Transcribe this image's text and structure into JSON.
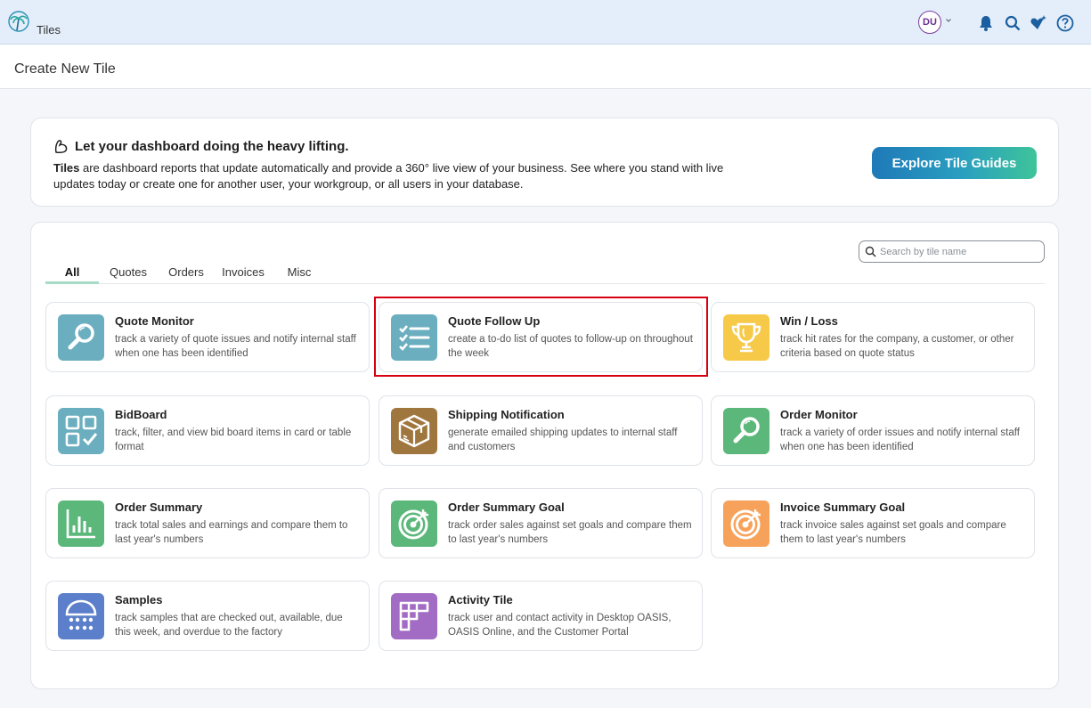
{
  "header": {
    "app_title": "Tiles",
    "avatar_initials": "DU"
  },
  "page": {
    "title": "Create New Tile"
  },
  "intro": {
    "heading": "Let your dashboard doing the heavy lifting.",
    "desc_bold": "Tiles",
    "desc_rest": " are dashboard reports that update automatically and provide a 360° live view of your business. See where you stand with live updates today or create one for another user, your workgroup, or all users in your database.",
    "button_label": "Explore Tile Guides"
  },
  "search": {
    "placeholder": "Search by tile name",
    "value": ""
  },
  "tabs": [
    {
      "label": "All",
      "active": true
    },
    {
      "label": "Quotes",
      "active": false
    },
    {
      "label": "Orders",
      "active": false
    },
    {
      "label": "Invoices",
      "active": false
    },
    {
      "label": "Misc",
      "active": false
    }
  ],
  "tiles": [
    {
      "title": "Quote Monitor",
      "desc": "track a variety of quote issues and notify internal staff when one has been identified",
      "icon": "magnifier-icon",
      "color": "#6aaebf"
    },
    {
      "title": "Quote Follow Up",
      "desc": "create a to-do list of quotes to follow-up on throughout the week",
      "icon": "checklist-icon",
      "color": "#6aaebf"
    },
    {
      "title": "Win / Loss",
      "desc": "track hit rates for the company, a customer, or other criteria based on quote status",
      "icon": "trophy-icon",
      "color": "#f7c948"
    },
    {
      "title": "BidBoard",
      "desc": "track, filter, and view bid board items in card or table format",
      "icon": "grid-check-icon",
      "color": "#6aaebf"
    },
    {
      "title": "Shipping Notification",
      "desc": "generate emailed shipping updates to internal staff and customers",
      "icon": "package-icon",
      "color": "#a0763f"
    },
    {
      "title": "Order Monitor",
      "desc": "track a variety of order issues and notify internal staff when one has been identified",
      "icon": "magnifier-icon",
      "color": "#5bb77a"
    },
    {
      "title": "Order Summary",
      "desc": "track total sales and earnings and compare them to last year's numbers",
      "icon": "bar-chart-icon",
      "color": "#5bb77a"
    },
    {
      "title": "Order Summary Goal",
      "desc": "track order sales against set goals and compare them to last year's numbers",
      "icon": "target-icon",
      "color": "#5bb77a"
    },
    {
      "title": "Invoice Summary Goal",
      "desc": "track invoice sales against set goals and compare them to last year's numbers",
      "icon": "target-icon",
      "color": "#f7a25a"
    },
    {
      "title": "Samples",
      "desc": "track samples that are checked out, available, due this week, and overdue to the factory",
      "icon": "samples-icon",
      "color": "#5b7fcb"
    },
    {
      "title": "Activity Tile",
      "desc": "track user and contact activity in Desktop OASIS, OASIS Online, and the Customer Portal",
      "icon": "activity-grid-icon",
      "color": "#a36cc4"
    }
  ]
}
